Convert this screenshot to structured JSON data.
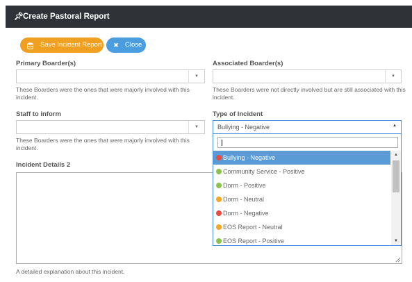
{
  "header": {
    "title": "Create Pastoral Report"
  },
  "toolbar": {
    "save_label": "Save Incident Report",
    "close_label": "Close"
  },
  "primary": {
    "label": "Primary Boarder(s)",
    "help": "These Boarders were the ones that were majorly involved with this incident."
  },
  "associated": {
    "label": "Associated Boarder(s)",
    "help": "These Boarders were not directly involved but are still associated with this incident."
  },
  "staff": {
    "label": "Staff to inform",
    "help": "These Boarders were the ones that were majorly involved with this incident."
  },
  "incident_type": {
    "label": "Type of Incident",
    "selected": "Bullying - Negative",
    "search_value": "",
    "options": [
      {
        "label": "Bullying - Negative",
        "color": "#e74c3c",
        "highlighted": true
      },
      {
        "label": "Community Service - Positive",
        "color": "#8bc34a",
        "highlighted": false
      },
      {
        "label": "Dorm - Positive",
        "color": "#8bc34a",
        "highlighted": false
      },
      {
        "label": "Dorm - Neutral",
        "color": "#f5a623",
        "highlighted": false
      },
      {
        "label": "Dorm - Negative",
        "color": "#e74c3c",
        "highlighted": false
      },
      {
        "label": "EOS Report - Neutral",
        "color": "#f5a623",
        "highlighted": false
      },
      {
        "label": "EOS Report - Positive",
        "color": "#8bc34a",
        "highlighted": false
      }
    ]
  },
  "details": {
    "label": "Incident Details 2",
    "value": "",
    "help": "A detailed explanation about this incident."
  },
  "icons": {
    "pin": "pin-icon",
    "save": "database-icon",
    "close": "close-icon"
  },
  "colors": {
    "save_button": "#f0a020",
    "close_button": "#4a9ee0",
    "header": "#2f3337",
    "highlight": "#5b9bd5"
  }
}
